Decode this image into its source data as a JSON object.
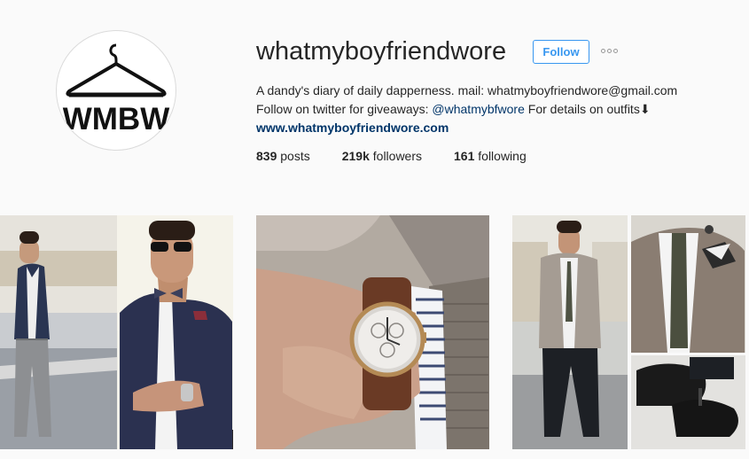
{
  "profile": {
    "logo_text": "WMBW",
    "username": "whatmyboyfriendwore",
    "follow_label": "Follow",
    "bio_line1": "A dandy's diary of daily dapperness. mail: whatmyboyfriendwore@gmail.com",
    "bio_line2_prefix": "Follow on twitter for giveaways: ",
    "twitter_handle": "@whatmybfwore",
    "bio_line2_suffix": " For details on outfits⬇",
    "website": "www.whatmyboyfriendwore.com"
  },
  "stats": {
    "posts_count": "839",
    "posts_label": "posts",
    "followers_count": "219k",
    "followers_label": "followers",
    "following_count": "161",
    "following_label": "following"
  },
  "colors": {
    "accent": "#3897f0",
    "link": "#003569",
    "background": "#fafafa",
    "text": "#262626"
  },
  "icons": {
    "options": "more-options-icon",
    "logo": "hanger-icon"
  }
}
